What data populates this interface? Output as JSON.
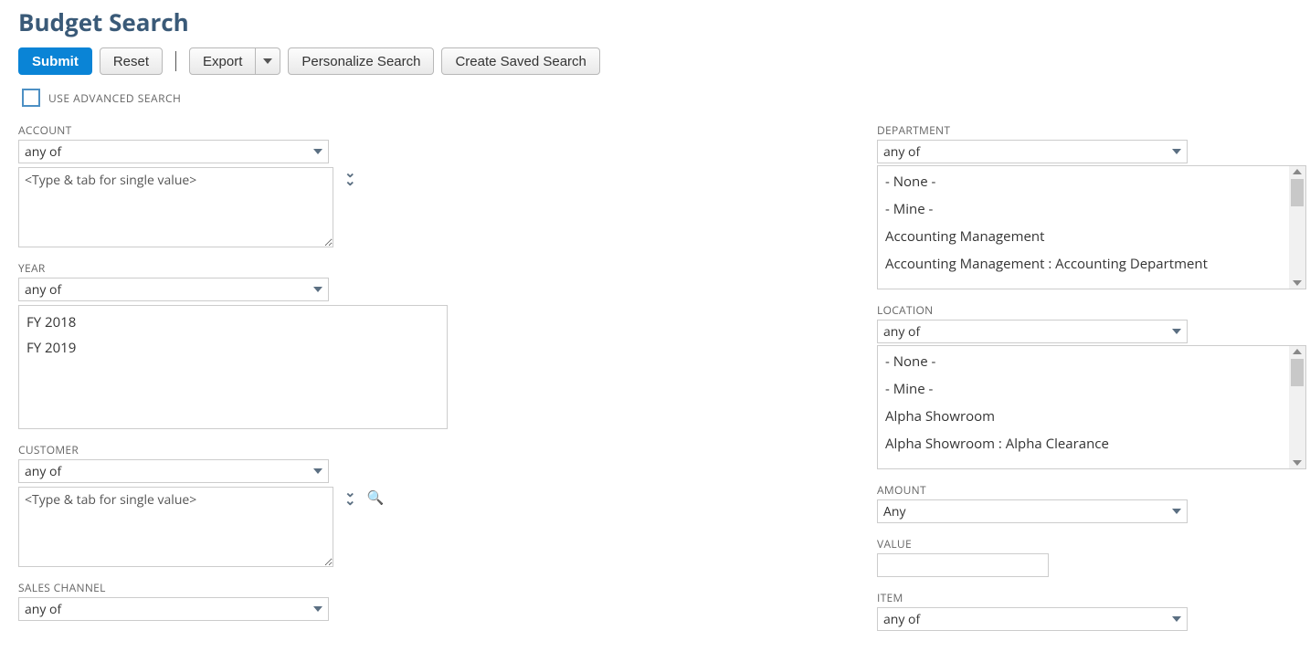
{
  "page": {
    "title": "Budget Search"
  },
  "toolbar": {
    "submit": "Submit",
    "reset": "Reset",
    "export": "Export",
    "personalize": "Personalize Search",
    "create_saved": "Create Saved Search"
  },
  "advanced": {
    "label": "USE ADVANCED SEARCH",
    "checked": false
  },
  "placeholders": {
    "type_tab": "<Type & tab for single value>"
  },
  "filters": {
    "account": {
      "label": "ACCOUNT",
      "op": "any of"
    },
    "year": {
      "label": "YEAR",
      "op": "any of",
      "options": [
        "FY 2018",
        "FY 2019"
      ]
    },
    "customer": {
      "label": "CUSTOMER",
      "op": "any of"
    },
    "sales_channel": {
      "label": "SALES CHANNEL",
      "op": "any of"
    },
    "department": {
      "label": "DEPARTMENT",
      "op": "any of",
      "options": [
        "- None -",
        "- Mine -",
        "Accounting Management",
        "Accounting Management : Accounting Department"
      ]
    },
    "location": {
      "label": "LOCATION",
      "op": "any of",
      "options": [
        "- None -",
        "- Mine -",
        "Alpha Showroom",
        "Alpha Showroom : Alpha Clearance"
      ]
    },
    "amount": {
      "label": "AMOUNT",
      "op": "Any"
    },
    "value": {
      "label": "VALUE",
      "val": ""
    },
    "item": {
      "label": "ITEM",
      "op": "any of"
    }
  }
}
